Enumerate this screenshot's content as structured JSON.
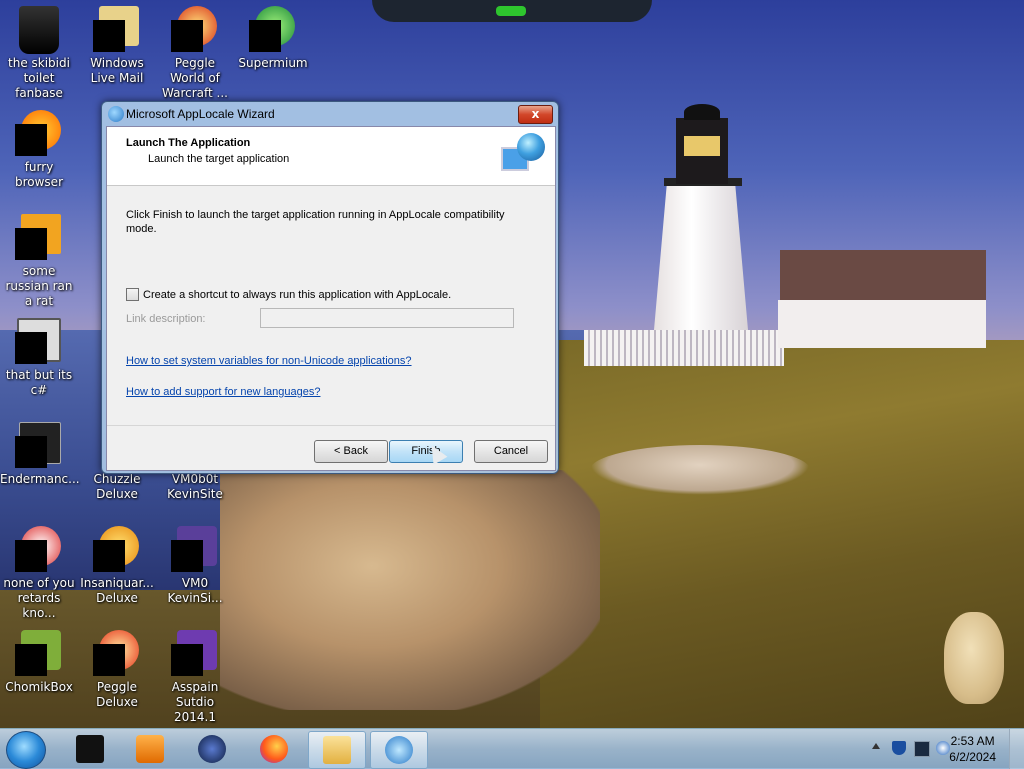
{
  "desktop": {
    "icons": [
      {
        "label": "the skibidi toilet fanbase",
        "icon": "trash-can-icon"
      },
      {
        "label": "Windows Live Mail",
        "icon": "mail-icon"
      },
      {
        "label": "Peggle World of Warcraft ...",
        "icon": "peggle-icon"
      },
      {
        "label": "Supermium",
        "icon": "browser-icon"
      },
      {
        "label": "furry browser",
        "icon": "firefox-icon"
      },
      {
        "label": "some russian ran a rat",
        "icon": "app-icon"
      },
      {
        "label": "that but its c#",
        "icon": "window-icon"
      },
      {
        "label": "Endermanc...",
        "icon": "app-icon"
      },
      {
        "label": "Chuzzle Deluxe",
        "icon": "game-icon"
      },
      {
        "label": "VM0b0t KevinSite",
        "icon": "app-icon"
      },
      {
        "label": "none of you retards kno...",
        "icon": "app-icon"
      },
      {
        "label": "Insaniquar... Deluxe",
        "icon": "game-icon"
      },
      {
        "label": "VM0 KevinSi...",
        "icon": "app-icon"
      },
      {
        "label": "ChomikBox",
        "icon": "app-icon"
      },
      {
        "label": "Peggle Deluxe",
        "icon": "peggle-icon"
      },
      {
        "label": "Asspain Sutdio 2014.1",
        "icon": "visual-studio-icon"
      }
    ]
  },
  "dialog": {
    "title": "Microsoft AppLocale Wizard",
    "close_label": "x",
    "header_title": "Launch The Application",
    "header_subtitle": "Launch the target application",
    "body": "Click Finish to launch the target application running in AppLocale compatibility mode.",
    "shortcut_checkbox_label": "Create a shortcut to always run this application with AppLocale.",
    "shortcut_checked": false,
    "link_description_label": "Link description:",
    "link_description_value": "",
    "link1": "How to set system variables for non-Unicode applications?",
    "link2": "How to add support for new languages?",
    "buttons": {
      "back": "< Back",
      "finish": "Finish",
      "cancel": "Cancel"
    }
  },
  "taskbar": {
    "items": [
      {
        "icon": "start-orb-icon"
      },
      {
        "icon": "terminal-icon"
      },
      {
        "icon": "media-player-icon"
      },
      {
        "icon": "globe-icon"
      },
      {
        "icon": "firefox-icon"
      },
      {
        "icon": "explorer-folder-icon",
        "active": true
      },
      {
        "icon": "applocale-icon",
        "active": true
      }
    ],
    "clock_time": "2:53 AM",
    "clock_date": "6/2/2024"
  },
  "colors": {
    "accent": "#2b8ad8",
    "link": "#0645ad",
    "close": "#c02d12"
  }
}
